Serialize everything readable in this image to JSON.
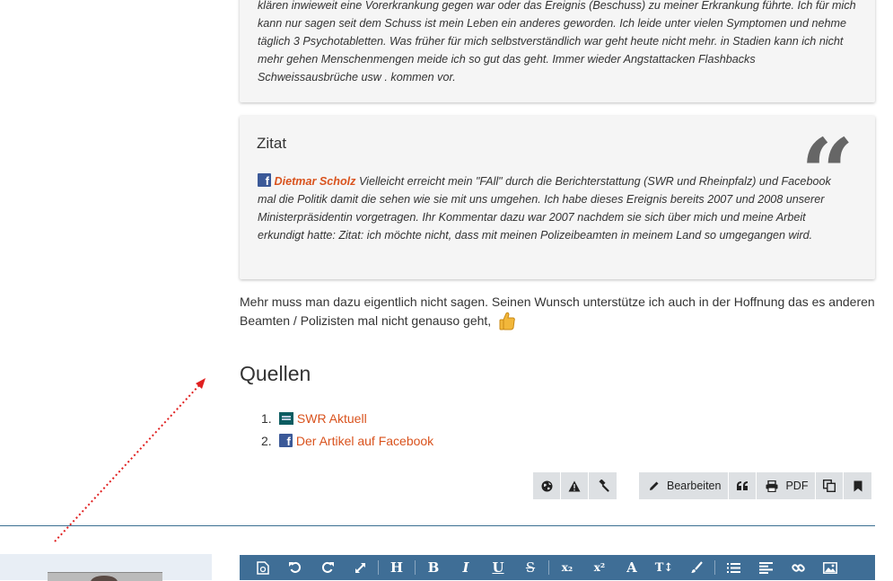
{
  "quote1": {
    "text": "klären inwieweit eine Vorerkrankung gegen war oder das Ereignis (Beschuss) zu meiner Erkrankung führte. Ich für mich kann nur sagen seit dem Schuss ist mein Leben ein anderes geworden. Ich leide unter vielen Symptomen und nehme täglich 3 Psychotabletten. Was früher für mich selbstverständlich war geht heute nicht mehr. in Stadien kann ich nicht mehr gehen Menschenmengen meide ich so gut das geht. Immer wieder Angstattacken Flashbacks Schweissausbrüche usw . kommen vor."
  },
  "quote2": {
    "title": "Zitat",
    "quote_mark": "“",
    "author": "Dietmar Scholz",
    "text": " Vielleicht erreicht mein \"FAll\" durch die Berichterstattung (SWR und Rheinpfalz) und Facebook mal die Politik damit die sehen wie sie mit uns umgehen. Ich habe dieses Ereignis bereits 2007 und 2008 unserer Ministerpräsidentin vorgetragen. Ihr Kommentar dazu war 2007 nachdem sie sich über mich und meine Arbeit erkundigt hatte: Zitat: ich möchte nicht, dass mit meinen Polizeibeamten in meinem Land so umgegangen wird."
  },
  "after_text": "Mehr muss man dazu eigentlich nicht sagen. Seinen Wunsch unterstütze ich auch in der Hoffnung das es anderen Beamten / Polizisten mal nicht genauso geht,",
  "quellen": {
    "heading": "Quellen",
    "items": [
      {
        "num": "1.",
        "label": "SWR Aktuell",
        "icon": "swr-icon"
      },
      {
        "num": "2.",
        "label": "Der Artikel auf Facebook",
        "icon": "facebook-icon"
      }
    ]
  },
  "toolbar": {
    "left_icons": [
      "globe-icon",
      "warning-icon",
      "gavel-icon"
    ],
    "edit_label": "Bearbeiten",
    "pdf_label": "PDF",
    "right_icons": [
      "quote-icon",
      "print-icon",
      "copy-icon",
      "bookmark-icon"
    ]
  },
  "editor_toolbar": {
    "buttons": [
      "source-icon",
      "undo-icon",
      "redo-icon",
      "fullscreen-icon",
      "heading-icon",
      "bold-icon",
      "italic-icon",
      "underline-icon",
      "strikethrough-icon",
      "subscript-icon",
      "superscript-icon",
      "font-color-icon",
      "font-size-icon",
      "brush-icon",
      "list-icon",
      "align-icon",
      "link-icon",
      "image-icon"
    ],
    "labels": {
      "heading": "H",
      "bold": "B",
      "italic": "I",
      "underline": "U",
      "strike": "S",
      "sub": "x₂",
      "sup": "x²",
      "font": "A",
      "size": "T↕"
    }
  },
  "colors": {
    "accent": "#d9531e",
    "toolbar_bg": "#dde0e3",
    "editor_bar": "#3f6e96",
    "divider": "#3a6f91",
    "arrow": "#e02020"
  }
}
